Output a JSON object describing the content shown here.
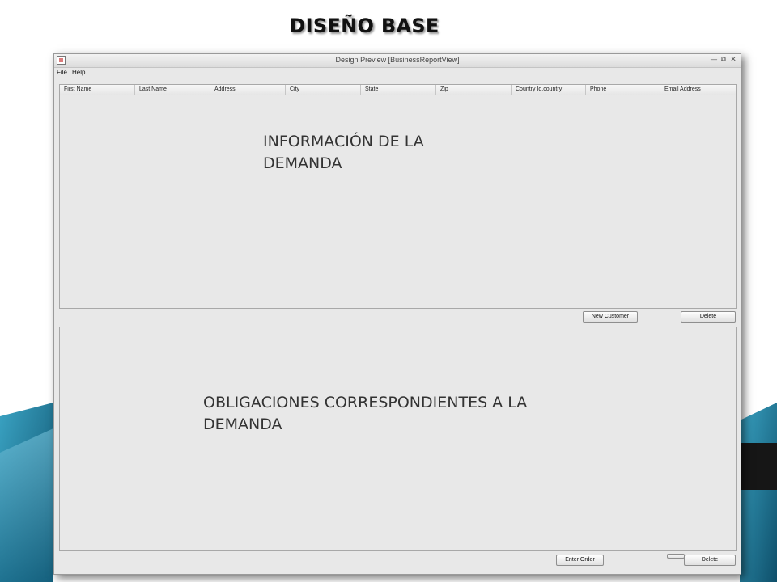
{
  "slide": {
    "title": "DISEÑO BASE"
  },
  "window": {
    "title": "Design Preview [BusinessReportView]",
    "controls": {
      "minimize": "—",
      "maximize": "⧉",
      "close": "✕"
    }
  },
  "menu": {
    "items": [
      "File",
      "Help"
    ]
  },
  "table": {
    "columns": [
      "First Name",
      "Last Name",
      "Address",
      "City",
      "State",
      "Zip",
      "Country Id.country",
      "Phone",
      "Email Address"
    ]
  },
  "top_panel": {
    "overlay_text": "INFORMACIÓN DE LA DEMANDA"
  },
  "top_buttons": {
    "new_customer": "New Customer",
    "delete": "Delete"
  },
  "bottom_panel": {
    "overlay_text": "OBLIGACIONES CORRESPONDIENTES A LA DEMANDA"
  },
  "bottom_buttons": {
    "enter_order": "Enter Order",
    "delete": "Delete"
  },
  "colors": {
    "window_bg": "#e8e8e8",
    "slide_accent_teal": "#1d7fa0",
    "slide_accent_dark": "#1a1a1a"
  }
}
